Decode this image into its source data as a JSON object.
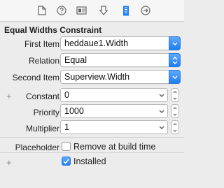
{
  "toolbar": {
    "icons": [
      "file-icon",
      "help-icon",
      "identity-icon",
      "attributes-icon",
      "size-inspector-icon",
      "connections-icon"
    ],
    "selected": "size-inspector-icon",
    "accent": "#1e7ef4"
  },
  "section_title": "Equal Widths Constraint",
  "first_item": {
    "label": "First Item",
    "value": "heddaue1.Width"
  },
  "relation": {
    "label": "Relation",
    "value": "Equal"
  },
  "second_item": {
    "label": "Second Item",
    "value": "Superview.Width"
  },
  "constant": {
    "label": "Constant",
    "value": "0"
  },
  "priority": {
    "label": "Priority",
    "value": "1000"
  },
  "multiplier": {
    "label": "Multiplier",
    "value": "1"
  },
  "placeholder": {
    "label": "Placeholder",
    "checkbox_label": "Remove at build time",
    "checked": false
  },
  "installed": {
    "label": "Installed",
    "checked": true
  },
  "plus_symbol": "+"
}
